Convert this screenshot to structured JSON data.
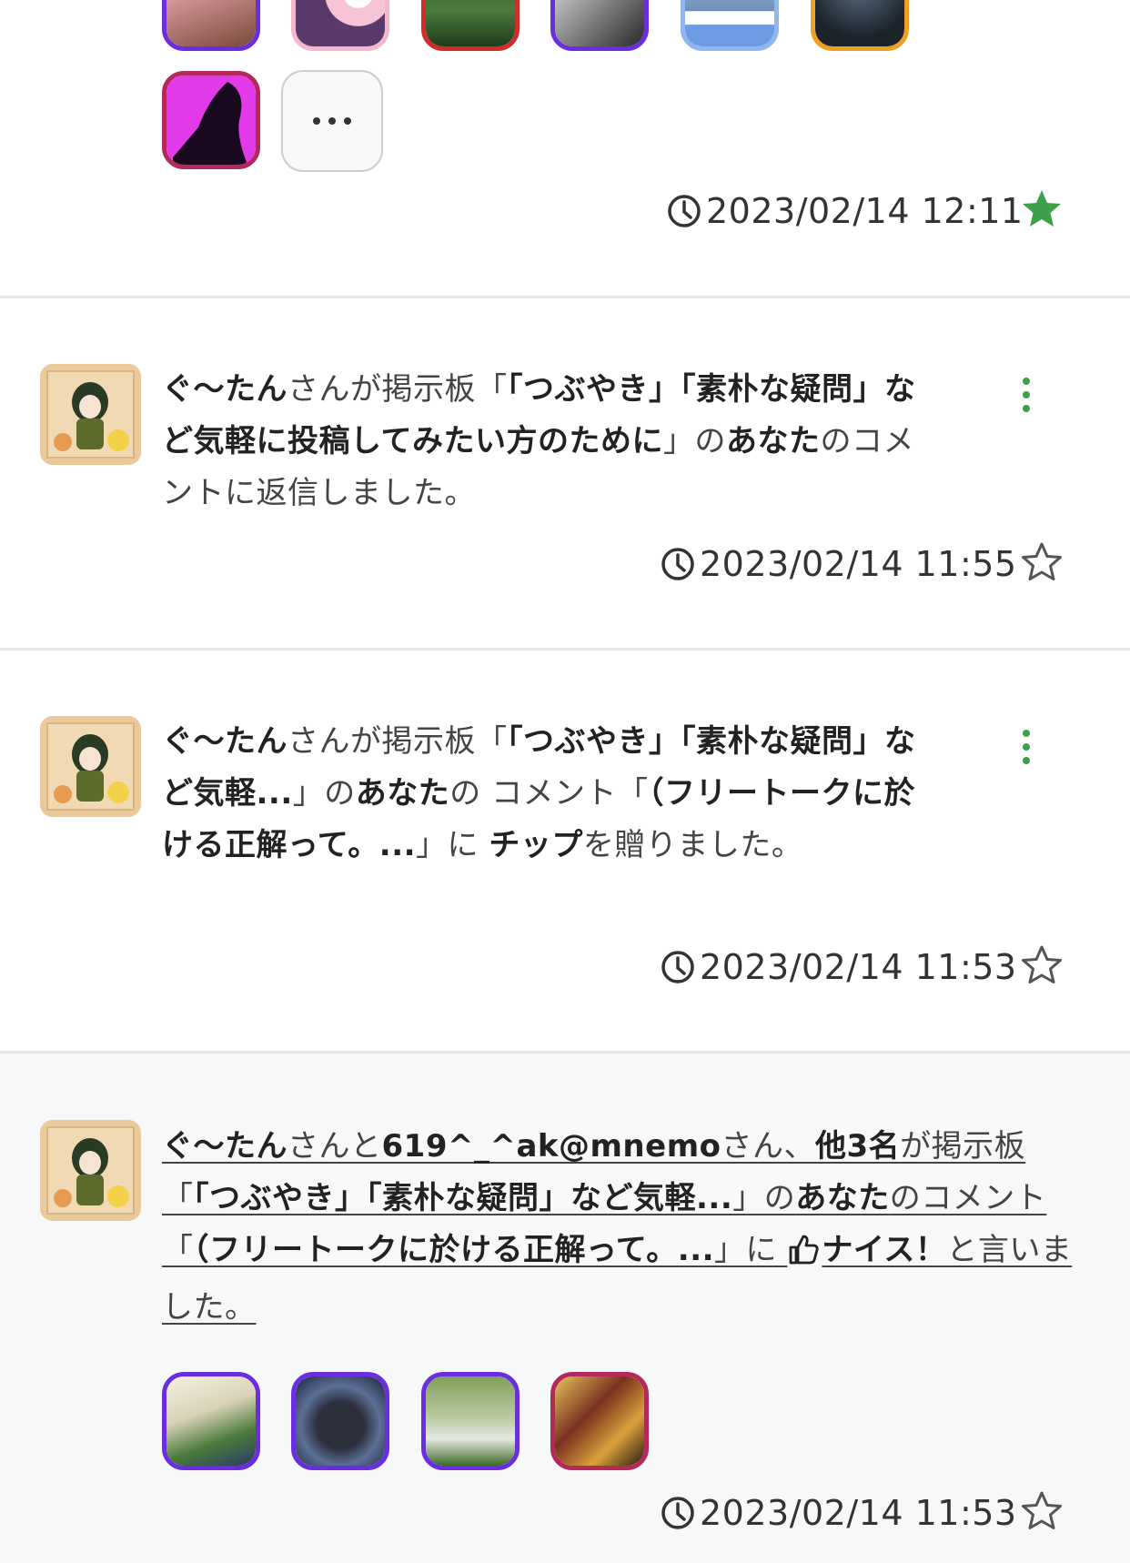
{
  "top_section": {
    "more_label": "...",
    "timestamp": "2023/02/14 12:11",
    "starred": true
  },
  "notifications": [
    {
      "user": "ぐ〜たん",
      "t1": "さんが掲示板「",
      "board": "「つぶやき」「素朴な疑問」など気軽に投稿してみたい方のために",
      "t2": "」の",
      "you": "あなた",
      "t3": "のコメントに返信しました。",
      "timestamp": "2023/02/14 11:55",
      "starred": false
    },
    {
      "user": "ぐ〜たん",
      "t1": "さんが掲示板「",
      "board": "「つぶやき」「素朴な疑問」など気軽...",
      "t2": "」の",
      "you": "あなた",
      "t3": "の コメント「",
      "comment": "（フリートークに於ける正解って。...",
      "t4": "」に ",
      "action": "チップ",
      "t5": "を贈りました。",
      "timestamp": "2023/02/14 11:53",
      "starred": false
    },
    {
      "user": "ぐ〜たん",
      "t1": "さんと",
      "user2": "619^_^ak@mnemo",
      "t2": "さん、",
      "others": "他3名",
      "t3": "が掲示板「",
      "board": "「つぶやき」「素朴な疑問」など気軽...",
      "t4": "」の",
      "you": "あなた",
      "t5": "のコメント「",
      "comment": "（フリートークに於ける正解って。...",
      "t6": "」に ",
      "action": "ナイス！",
      "t7": "と言いました。",
      "timestamp": "2023/02/14 11:53",
      "starred": false
    }
  ],
  "colors": {
    "accent_green": "#3da04a",
    "thumb_purple": "#6a2de0",
    "thumb_red": "#d12b2b",
    "thumb_orange": "#f0a020",
    "thumb_crimson": "#b4285a"
  },
  "icons": {
    "clock": "clock-icon",
    "star": "star-icon",
    "kebab": "more-vertical-icon",
    "thumbs_up": "thumbs-up-icon"
  }
}
